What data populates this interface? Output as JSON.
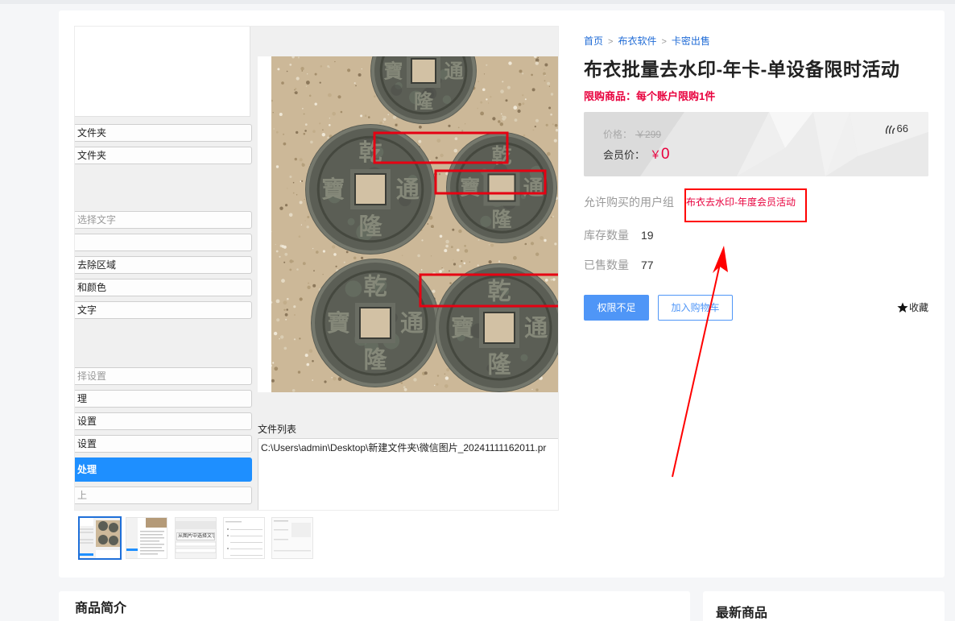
{
  "breadcrumb": {
    "items": [
      "首页",
      "布衣软件",
      "卡密出售"
    ],
    "separator": ">"
  },
  "product": {
    "title": "布衣批量去水印-年卡-单设备限时活动",
    "limit_notice": "限购商品：每个账户限购1件",
    "price_label": "价格：",
    "original_price": "￥299",
    "member_price_label": "会员价：",
    "member_price_currency": "￥",
    "member_price_amount": "0",
    "heat_count": "66",
    "allowed_group_label": "允许购买的用户组",
    "allowed_group_value": "布衣去水印-年度会员活动",
    "stock_label": "库存数量",
    "stock_value": "19",
    "sold_label": "已售数量",
    "sold_value": "77"
  },
  "actions": {
    "buy_label": "权限不足",
    "cart_label": "加入购物车",
    "favorite_label": "收藏"
  },
  "gallery": {
    "selected_thumbnail": 1,
    "app_buttons": [
      "文件夹",
      "文件夹",
      "选择文字",
      "去除区域",
      "和颜色",
      "文字",
      "择设置",
      "理",
      "设置",
      "设置",
      "处理",
      "上"
    ],
    "file_list_label": "文件列表",
    "file_path": "C:\\Users\\admin\\Desktop\\新建文件夹\\微信图片_20241111162011.pr",
    "coin_inscription": {
      "top": "乾",
      "right": "通",
      "bottom": "隆",
      "left": "寶"
    },
    "thumbnail_caption": "从图片中选择文字"
  },
  "sections": {
    "intro_title": "商品简介",
    "latest_title": "最新商品"
  },
  "icons": {
    "heat": "flame-icon",
    "favorite": "star-icon"
  },
  "colors": {
    "link": "#1f6bd6",
    "accent_red": "#e8003d",
    "primary_button": "#4f96f7",
    "app_primary": "#1e8fff",
    "annotation": "#ff0000"
  }
}
